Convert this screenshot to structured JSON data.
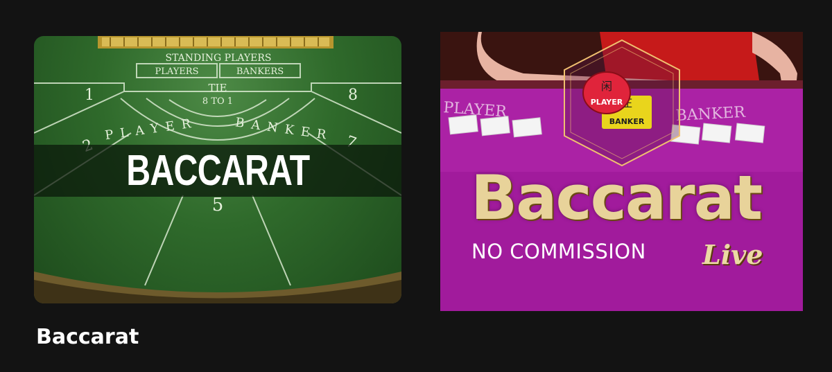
{
  "tiles": [
    {
      "banner": "BACCARAT",
      "table_labels": {
        "standing": "STANDING PLAYERS",
        "players": "PLAYERS",
        "bankers": "BANKERS",
        "tie": "TIE",
        "tie_odds": "8 TO 1",
        "player_word": "PLAYER",
        "banker_word": "BANKER",
        "seat_numbers": [
          "1",
          "2",
          "5",
          "7",
          "8"
        ]
      }
    },
    {
      "title": "Baccarat",
      "subtitle": "NO COMMISSION",
      "tag": "Live",
      "felt_text_left": "PLAYER",
      "felt_text_right": "BANKER",
      "chip_player": "PLAYER",
      "chip_banker": "BANKER",
      "chip_glyph_player": "闲",
      "chip_glyph_banker": "庄"
    }
  ],
  "section_title": "Baccarat",
  "colors": {
    "page_bg": "#131313",
    "felt_green": "#2f6a2b",
    "felt_purple": "#a0189a",
    "gold": "#e8d39a"
  }
}
